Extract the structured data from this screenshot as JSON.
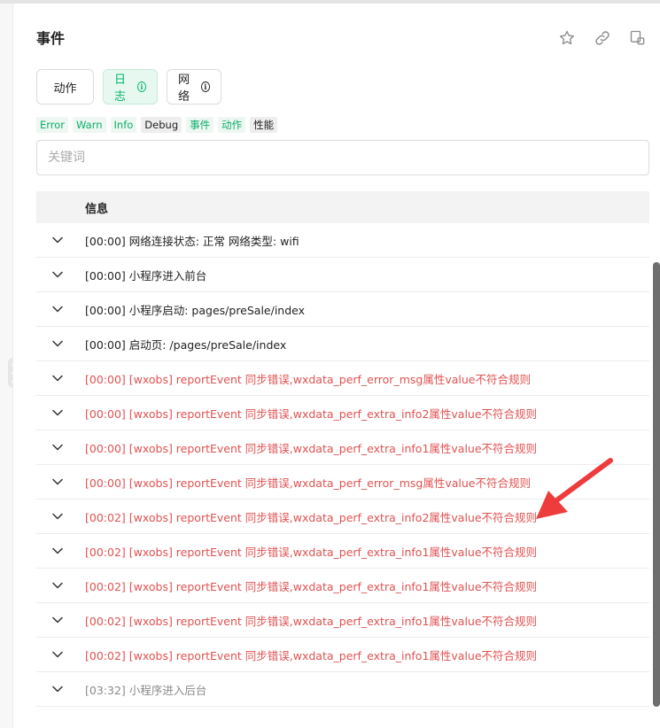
{
  "panel": {
    "title": "事件"
  },
  "header_icons": [
    "star-icon",
    "link-icon",
    "copy-icon"
  ],
  "tabs": [
    {
      "label": "动作",
      "active": false,
      "info": false
    },
    {
      "label": "日志",
      "active": true,
      "info": true
    },
    {
      "label": "网络",
      "active": false,
      "info": true
    }
  ],
  "filters": [
    "Error",
    "Warn",
    "Info",
    "Debug",
    "事件",
    "动作",
    "性能"
  ],
  "search": {
    "placeholder": "关键词",
    "value": ""
  },
  "table": {
    "header": "信息",
    "rows": [
      {
        "text": "[00:00] 网络连接状态: 正常 网络类型: wifi",
        "level": "normal"
      },
      {
        "text": "[00:00] 小程序进入前台",
        "level": "normal"
      },
      {
        "text": "[00:00] 小程序启动: pages/preSale/index",
        "level": "normal"
      },
      {
        "text": "[00:00] 启动页: /pages/preSale/index",
        "level": "normal"
      },
      {
        "text": "[00:00] [wxobs] reportEvent 同步错误,wxdata_perf_error_msg属性value不符合规则",
        "level": "error"
      },
      {
        "text": "[00:00] [wxobs] reportEvent 同步错误,wxdata_perf_extra_info2属性value不符合规则",
        "level": "error"
      },
      {
        "text": "[00:00] [wxobs] reportEvent 同步错误,wxdata_perf_extra_info1属性value不符合规则",
        "level": "error"
      },
      {
        "text": "[00:00] [wxobs] reportEvent 同步错误,wxdata_perf_error_msg属性value不符合规则",
        "level": "error"
      },
      {
        "text": "[00:02] [wxobs] reportEvent 同步错误,wxdata_perf_extra_info2属性value不符合规则",
        "level": "error"
      },
      {
        "text": "[00:02] [wxobs] reportEvent 同步错误,wxdata_perf_extra_info1属性value不符合规则",
        "level": "error"
      },
      {
        "text": "[00:02] [wxobs] reportEvent 同步错误,wxdata_perf_extra_info1属性value不符合规则",
        "level": "error"
      },
      {
        "text": "[00:02] [wxobs] reportEvent 同步错误,wxdata_perf_extra_info1属性value不符合规则",
        "level": "error"
      },
      {
        "text": "[00:02] [wxobs] reportEvent 同步错误,wxdata_perf_extra_info1属性value不符合规则",
        "level": "error"
      },
      {
        "text": "[03:32] 小程序进入后台",
        "level": "dim"
      }
    ]
  },
  "colors": {
    "accent_green": "#08b36b",
    "error_red": "#e15252",
    "annotation_arrow": "#ee3b3b"
  }
}
